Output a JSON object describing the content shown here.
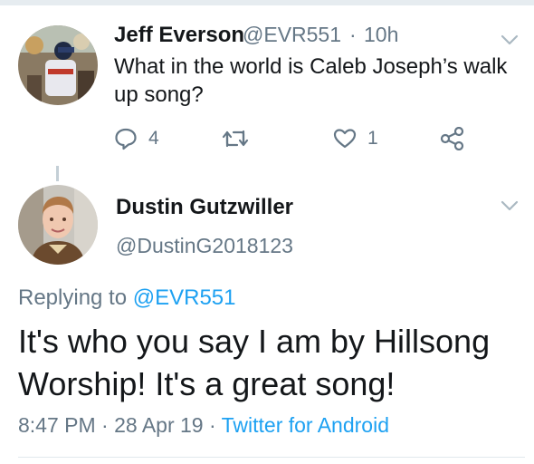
{
  "tweet1": {
    "name": "Jeff Everson",
    "handle": "@EVR551",
    "separator": "·",
    "time": "10h",
    "text": "What in the world is Caleb Joseph’s walk up song?",
    "reply_count": "4",
    "like_count": "1",
    "actions": {
      "reply": "reply-icon",
      "retweet": "retweet-icon",
      "like": "heart-icon",
      "share": "share-icon"
    }
  },
  "tweet2": {
    "name": "Dustin Gutzwiller",
    "handle": "@DustinG2018123",
    "replying_prefix": "Replying to",
    "replying_to": "@EVR551",
    "text": "It's who you say I am by Hillsong Worship!  It's a great song!",
    "time": "8:47 PM",
    "separator1": "·",
    "date": "28 Apr 19",
    "separator2": "·",
    "source": "Twitter for Android"
  },
  "colors": {
    "text": "#14171a",
    "secondary": "#657786",
    "link": "#1da1f2",
    "divider": "#e1e8ed"
  }
}
